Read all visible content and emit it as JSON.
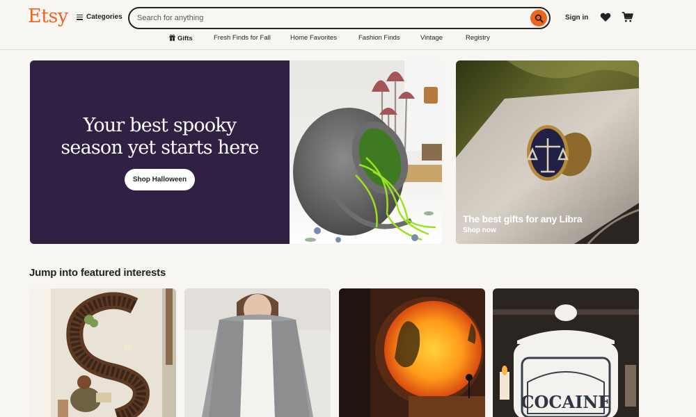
{
  "header": {
    "logo": "Etsy",
    "categories_label": "Categories",
    "search_placeholder": "Search for anything",
    "signin_label": "Sign in"
  },
  "nav": {
    "items": [
      "Gifts",
      "Fresh Finds for Fall",
      "Home Favorites",
      "Fashion Finds",
      "Vintage",
      "Registry"
    ]
  },
  "hero": {
    "title_line1": "Your best spooky",
    "title_line2": "season yet starts here",
    "button_label": "Shop Halloween"
  },
  "promo": {
    "title": "The best gifts for any Libra",
    "cta": "Shop now"
  },
  "featured": {
    "heading": "Jump into featured interests",
    "cards": [
      {
        "image": "s-shaped-bookshelf-photo"
      },
      {
        "image": "gray-wrap-shawl-photo"
      },
      {
        "image": "sunset-lamp-photo"
      },
      {
        "image": "apothecary-jar-photo"
      }
    ]
  },
  "colors": {
    "brand": "#f1641e",
    "hero_bg": "#2f2044",
    "page_bg": "#f8f6f3"
  }
}
